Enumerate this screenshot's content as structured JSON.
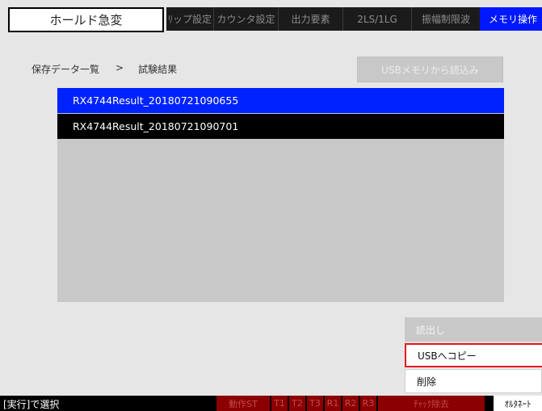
{
  "header": {
    "title": "ホールド急変",
    "tabs": [
      {
        "label": "ﾘップ設定",
        "active": false
      },
      {
        "label": "カウンタ設定",
        "active": false
      },
      {
        "label": "出力要素",
        "active": false
      },
      {
        "label": "2LS/1LG",
        "active": false
      },
      {
        "label": "振幅制限波",
        "active": false
      },
      {
        "label": "メモリ操作",
        "active": true
      }
    ]
  },
  "breadcrumb": {
    "parent": "保存データ一覧",
    "separator": ">",
    "current": "試験結果"
  },
  "buttons": {
    "usb_read": "USBメモリから読込み",
    "read": "読出し",
    "copy_to_usb": "USBへコピー",
    "delete": "削除"
  },
  "files": [
    {
      "name": "RX4744Result_20180721090655",
      "selected": true
    },
    {
      "name": "RX4744Result_20180721090701",
      "selected": false
    }
  ],
  "status_bar": {
    "message": "[実行]で選択",
    "indicators": [
      "動作ST",
      "T1",
      "T2",
      "T3",
      "R1",
      "R2",
      "R3",
      "ﾁｬｯｸ除去"
    ],
    "alternate": "ｵﾙﾀﾈｰﾄ"
  },
  "colors": {
    "active_tab": "#0018ff",
    "selected_row": "#0022ff",
    "focus_border": "#e6161f",
    "indicator_off": "#8b0000"
  }
}
